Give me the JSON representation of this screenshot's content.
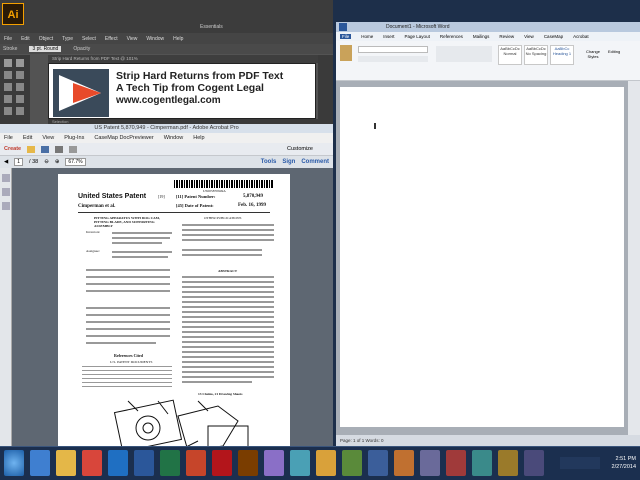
{
  "illustrator": {
    "tab_label": "Strip Hard Returns from PDF Text @ 101%",
    "menu": [
      "File",
      "Edit",
      "Object",
      "Type",
      "Select",
      "Effect",
      "View",
      "Window",
      "Help"
    ],
    "ctrl_stroke_label": "Stroke",
    "ctrl_round_label": "3 pt. Round",
    "ctrl_opacity_label": "Opacity",
    "status_label": "Selection",
    "essentials": "Essentials",
    "canvas": {
      "line1": "Strip Hard Returns from PDF Text",
      "line2": "A Tech Tip from Cogent Legal",
      "line3": "www.cogentlegal.com"
    }
  },
  "acrobat": {
    "title": "US Patent 5,870,949 - Cimperman.pdf - Adobe Acrobat Pro",
    "menu": [
      "File",
      "Edit",
      "View",
      "Plug-Ins",
      "Window",
      "CaseMap DocPreviewer",
      "Window",
      "Help"
    ],
    "create_label": "Create",
    "customize_label": "Customize",
    "page_current": "1",
    "page_total": "/ 38",
    "zoom": "67.7%",
    "tools_label": "Tools",
    "sign_label": "Sign",
    "comment_label": "Comment",
    "patent": {
      "number_barcode": "US005870949A",
      "heading": "United States Patent",
      "heading_code": "[19]",
      "inventor": "Cimperman et al.",
      "patent_no_label": "[11]  Patent Number:",
      "patent_no": "5,870,949",
      "date_label": "[45]  Date of Patent:",
      "date": "Feb. 16, 1999",
      "title": "PITTING APPARATUS WITH DOG CAM, PITTING BLADE, AND SUPPORTING ASSEMBLY",
      "inventors_label": "Inventors:",
      "assignee_label": "Assignee:",
      "references_label": "References Cited",
      "us_docs_label": "U.S. PATENT DOCUMENTS",
      "other_pubs_label": "OTHER PUBLICATIONS",
      "abstract_label": "ABSTRACT",
      "claims_label": "13 Claims, 21 Drawing Sheets"
    }
  },
  "word": {
    "title": "Document1 - Microsoft Word",
    "tabs": [
      "File",
      "Home",
      "Insert",
      "Page Layout",
      "References",
      "Mailings",
      "Review",
      "View",
      "CaseMap",
      "Acrobat"
    ],
    "styles": [
      "AaBbCcDc",
      "AaBbCcDc",
      "AaBbCc",
      "AaBbCc"
    ],
    "style_names": [
      "Normal",
      "No Spacing",
      "Heading 1",
      "Heading 2"
    ],
    "change_styles": "Change Styles",
    "editing": "Editing",
    "status": "Page: 1 of 1   Words: 0"
  },
  "taskbar": {
    "time": "2:51 PM",
    "date": "2/27/2014"
  }
}
